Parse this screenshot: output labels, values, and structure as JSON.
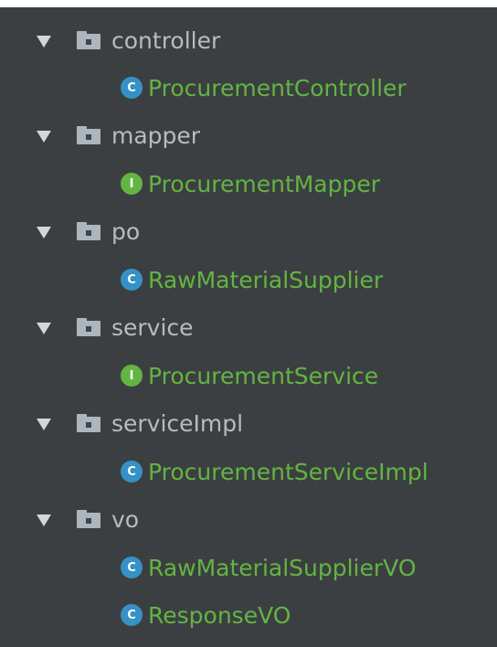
{
  "tree": {
    "items": [
      {
        "kind": "folder",
        "label": "controller",
        "icon": "folder-icon",
        "expanded": true
      },
      {
        "kind": "class",
        "badge": "C",
        "label": "ProcurementController",
        "icon": "class-icon"
      },
      {
        "kind": "folder",
        "label": "mapper",
        "icon": "folder-icon",
        "expanded": true
      },
      {
        "kind": "interface",
        "badge": "I",
        "label": "ProcurementMapper",
        "icon": "interface-icon"
      },
      {
        "kind": "folder",
        "label": "po",
        "icon": "folder-icon",
        "expanded": true
      },
      {
        "kind": "class",
        "badge": "C",
        "label": "RawMaterialSupplier",
        "icon": "class-icon"
      },
      {
        "kind": "folder",
        "label": "service",
        "icon": "folder-icon",
        "expanded": true
      },
      {
        "kind": "interface",
        "badge": "I",
        "label": "ProcurementService",
        "icon": "interface-icon"
      },
      {
        "kind": "folder",
        "label": "serviceImpl",
        "icon": "folder-icon",
        "expanded": true
      },
      {
        "kind": "class",
        "badge": "C",
        "label": "ProcurementServiceImpl",
        "icon": "class-icon"
      },
      {
        "kind": "folder",
        "label": "vo",
        "icon": "folder-icon",
        "expanded": true
      },
      {
        "kind": "class",
        "badge": "C",
        "label": "RawMaterialSupplierVO",
        "icon": "class-icon"
      },
      {
        "kind": "class",
        "badge": "C",
        "label": "ResponseVO",
        "icon": "class-icon"
      }
    ]
  },
  "colors": {
    "background": "#3c3f41",
    "folder_text": "#bbbbbb",
    "class_text": "#62b543",
    "class_badge": "#3592c4",
    "interface_badge": "#62b543"
  }
}
